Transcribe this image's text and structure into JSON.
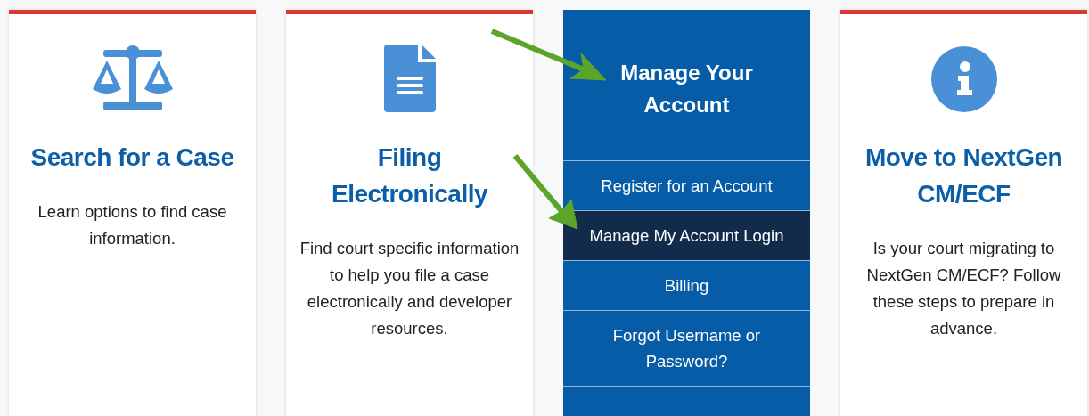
{
  "cards": [
    {
      "kind": "info",
      "title": "Search for a Case",
      "text": "Learn options to find case information."
    },
    {
      "kind": "info",
      "title": "Filing Electronically",
      "text": "Find court specific information to help you file a case electronically and developer resources."
    },
    {
      "kind": "menu",
      "title": "Manage Your Account",
      "items": [
        {
          "label": "Register for an Account",
          "selected": false
        },
        {
          "label": "Manage My Account Login",
          "selected": true
        },
        {
          "label": "Billing",
          "selected": false
        },
        {
          "label": "Forgot Username or Password?",
          "selected": false
        }
      ]
    },
    {
      "kind": "info",
      "title": "Move to NextGen CM/ECF",
      "text": "Is your court migrating to NextGen CM/ECF? Follow these steps to prepare in advance."
    }
  ]
}
